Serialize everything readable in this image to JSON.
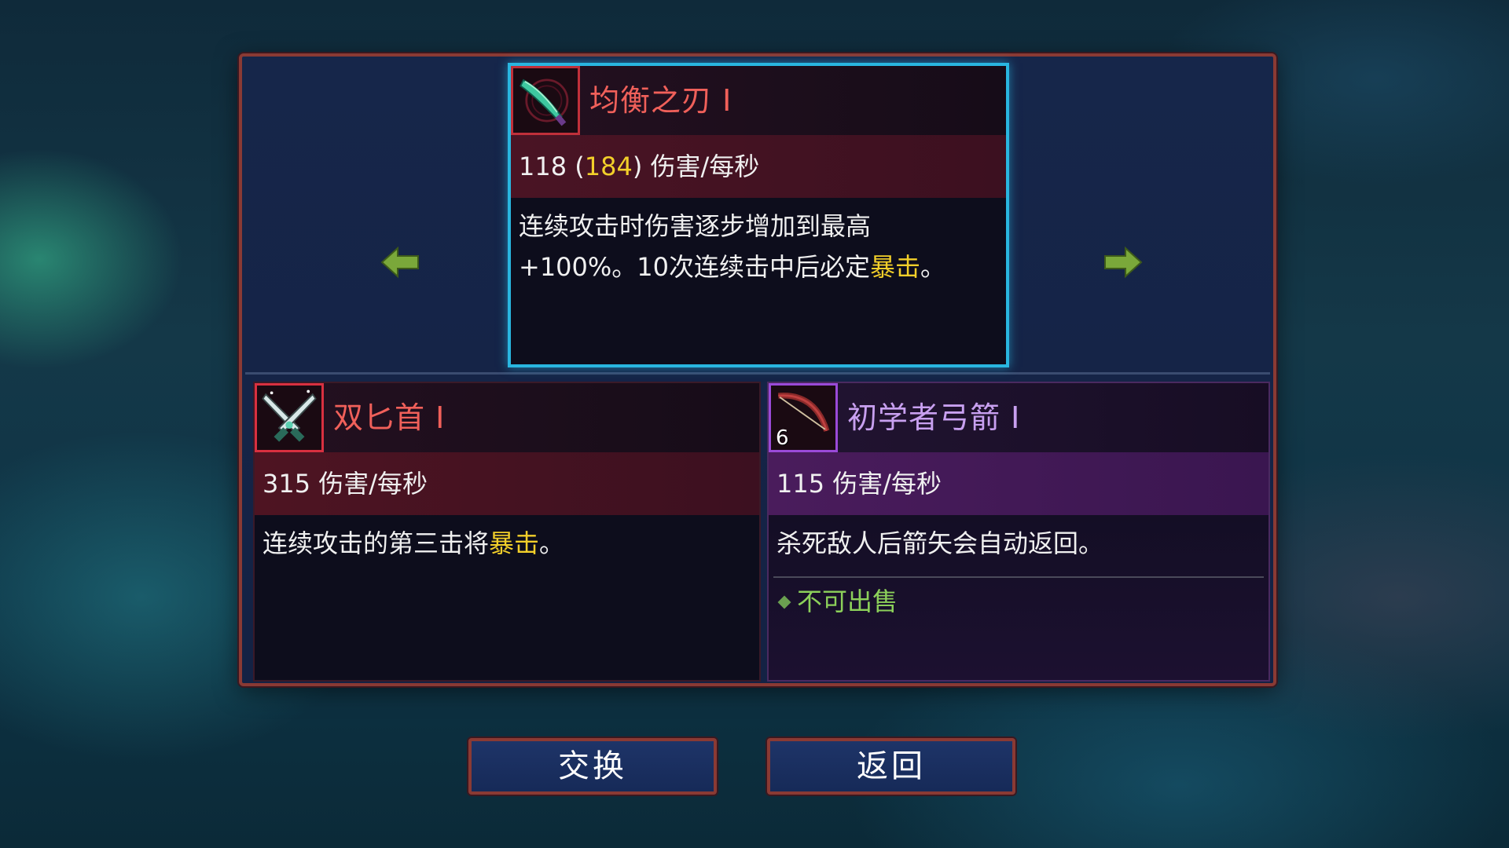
{
  "top_card": {
    "icon": "balanced-blade-icon",
    "name": "均衡之刃 I",
    "stat_base": "118 (",
    "stat_bonus": "184",
    "stat_suffix": ") 伤害/每秒",
    "desc_line1": "连续攻击时伤害逐步增加到最高",
    "desc_line2_pre": "+100%。10次连续击中后必定",
    "desc_line2_hl": "暴击",
    "desc_line2_post": "。"
  },
  "bottom_left_card": {
    "icon": "twin-daggers-icon",
    "name": "双匕首 I",
    "stat": "315 伤害/每秒",
    "desc_pre": "连续攻击的第三击将",
    "desc_hl": "暴击",
    "desc_post": "。"
  },
  "bottom_right_card": {
    "icon": "beginner-bow-icon",
    "count": "6",
    "name": "初学者弓箭 I",
    "stat": "115 伤害/每秒",
    "desc": "杀死敌人后箭矢会自动返回。",
    "tag": "不可出售"
  },
  "nav": {
    "left_icon": "arrow-left-icon",
    "right_icon": "arrow-right-icon"
  },
  "buttons": {
    "swap": "交换",
    "back": "返回"
  },
  "colors": {
    "selected_border": "#29b6e0",
    "highlight_yellow": "#f2cf2a",
    "name_red": "#f0605a",
    "name_purple": "#c8a0f0",
    "tag_green": "#8cd05a",
    "arrow_green": "#7aa83a"
  }
}
